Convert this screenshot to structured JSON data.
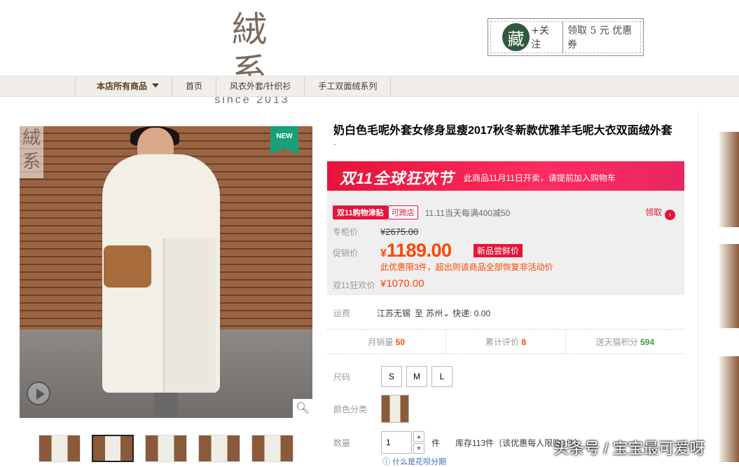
{
  "header": {
    "logo_cn": "絨系",
    "logo_en": "since 2013",
    "fav_seal": "藏",
    "fav_follow": "+关注",
    "fav_coupon": "领取 5 元 优惠券"
  },
  "nav": {
    "items": [
      "本店所有商品",
      "首页",
      "风衣外套/针织衫",
      "手工双面绒系列"
    ]
  },
  "gallery": {
    "watermark": "絨系",
    "new_badge": "NEW",
    "zoom_icon": "search-icon",
    "play_icon": "play-icon",
    "thumb_count": 5
  },
  "product": {
    "title": "奶白色毛呢外套女修身显瘦2017秋冬新款优雅羊毛呢大衣双面绒外套",
    "subtitle": "-",
    "banner_logo": "双11全球狂欢节",
    "banner_text": "此商品11月11日开卖，请提前加入购物车",
    "tag_double11": "双11购物津贴",
    "tag_cross": "可跨店",
    "promo_desc": "11.11当天每满400减50",
    "get_label": "领取",
    "price_label_old": "专柜价",
    "price_old": "¥2675.00",
    "price_label_promo": "促销价",
    "price_currency": "¥",
    "price_promo": "1189.00",
    "price_badge": "新品尝鲜价",
    "limit_note": "此优惠限3件，超出则该商品全部恢复非活动价",
    "price_label_d11": "双11狂欢价",
    "price_d11": "¥1070.00"
  },
  "shipping": {
    "label": "运费",
    "from": "江苏无锡",
    "to_prefix": "至",
    "to": "苏州",
    "method": "快递: 0.00"
  },
  "stats": {
    "monthly_label": "月销量",
    "monthly": "50",
    "reviews_label": "累计评价",
    "reviews": "8",
    "points_label": "送天猫积分",
    "points": "594"
  },
  "options": {
    "size_label": "尺码",
    "sizes": [
      "S",
      "M",
      "L"
    ],
    "color_label": "颜色分类",
    "qty_label": "数量",
    "qty_value": "1",
    "qty_unit": "件",
    "stock": "库存113件（该优惠每人限购3件）"
  },
  "footer": {
    "watermark": "头条号 / 宝宝最可爱呀",
    "partial_link": "什么是花呗分期"
  }
}
